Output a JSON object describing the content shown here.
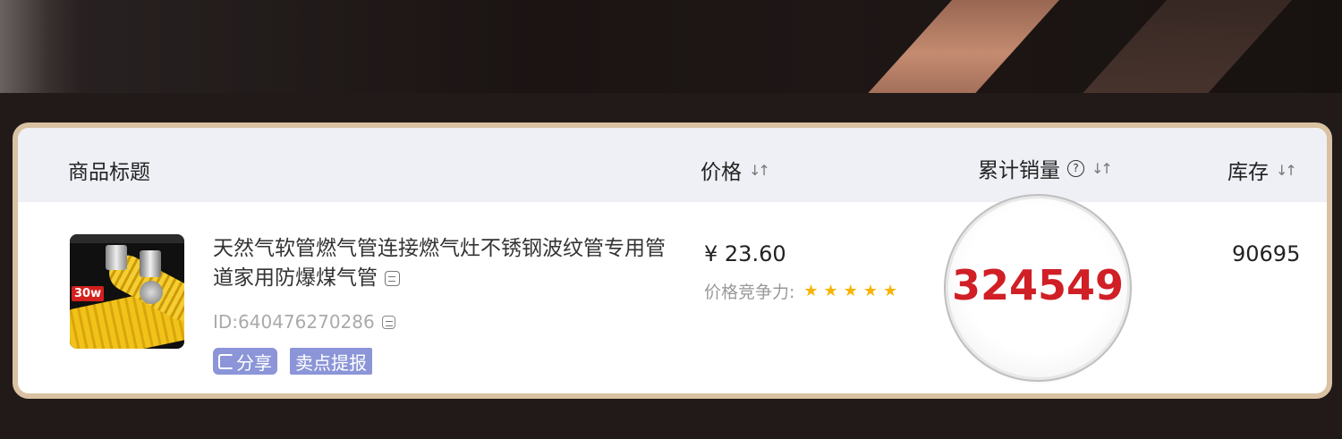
{
  "table": {
    "headers": {
      "title": "商品标题",
      "price": "价格",
      "sales": "累计销量",
      "stock": "库存"
    }
  },
  "product": {
    "title": "天然气软管燃气管连接燃气灶不锈钢波纹管专用管道家用防爆煤气管",
    "id": "ID:640476270286",
    "tags": [
      "分享",
      "卖点提报"
    ],
    "thumbnail_text": "30w",
    "price": "¥ 23.60",
    "price_competitiveness_label": "价格竞争力:",
    "price_competitiveness_stars": 5,
    "sales_total": "324549",
    "stock": "90695"
  },
  "icons": {
    "sort": "sort-icon",
    "help": "help-icon",
    "copy": "copy-icon",
    "share": "share-icon",
    "star": "star-icon"
  },
  "colors": {
    "sales_highlight": "#d01f25",
    "tag_bg": "#8b95d8",
    "star": "#f6b400",
    "card_border": "#d9c2a3"
  }
}
